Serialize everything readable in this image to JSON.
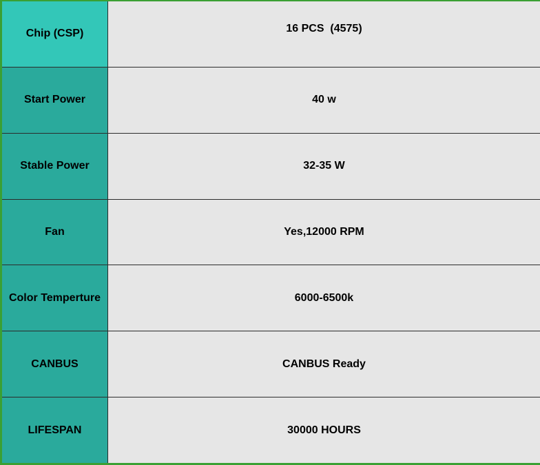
{
  "colors": {
    "outer_border": "#3aa033",
    "label_bg_first": "#33c7b8",
    "label_bg": "#2aaa9c",
    "value_bg": "#e6e6e6",
    "grid_line": "#2b2b2b",
    "text": "#000000"
  },
  "spec_table": {
    "rows": [
      {
        "label": "Chip (CSP)",
        "value": "16 PCS  (4575)"
      },
      {
        "label": "Start Power",
        "value": "40 w"
      },
      {
        "label": "Stable Power",
        "value": "32-35 W"
      },
      {
        "label": "Fan",
        "value": "Yes,12000 RPM"
      },
      {
        "label": "Color Temperture",
        "value": "6000-6500k"
      },
      {
        "label": "CANBUS",
        "value": "CANBUS Ready"
      },
      {
        "label": "LIFESPAN",
        "value": "30000 HOURS"
      }
    ]
  }
}
